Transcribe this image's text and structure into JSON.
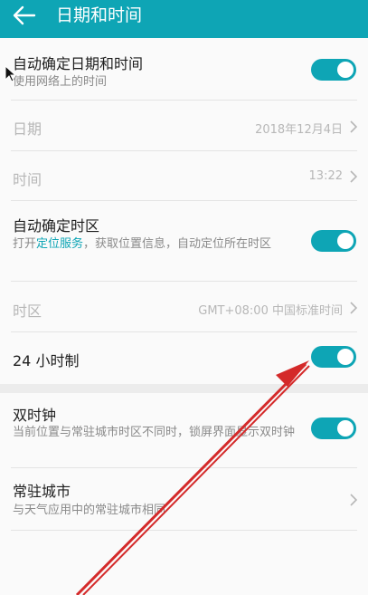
{
  "header": {
    "title": "日期和时间"
  },
  "settings": {
    "auto_datetime": {
      "label": "自动确定日期和时间",
      "sub": "使用网络上的时间",
      "on": true
    },
    "date": {
      "label": "日期",
      "value": "2018年12月4日"
    },
    "time": {
      "label": "时间",
      "value": "13:22"
    },
    "auto_timezone": {
      "label": "自动确定时区",
      "sub_pre": "打开",
      "sub_link": "定位服务",
      "sub_post": "，获取位置信息，自动定位所在时区",
      "on": true
    },
    "timezone": {
      "label": "时区",
      "value": "GMT+08:00 中国标准时间"
    },
    "hour24": {
      "label": "24 小时制",
      "on": true
    },
    "dual_clock": {
      "label": "双时钟",
      "sub": "当前位置与常驻城市时区不同时，锁屏界面显示双时钟",
      "on": true
    },
    "home_city": {
      "label": "常驻城市",
      "sub": "与天气应用中的常驻城市相同"
    }
  },
  "colors": {
    "accent": "#0ea5b5",
    "annotation_arrow": "#d42a2a"
  },
  "icons": {
    "back": "arrow-left-icon",
    "chevron": "chevron-right-icon"
  }
}
